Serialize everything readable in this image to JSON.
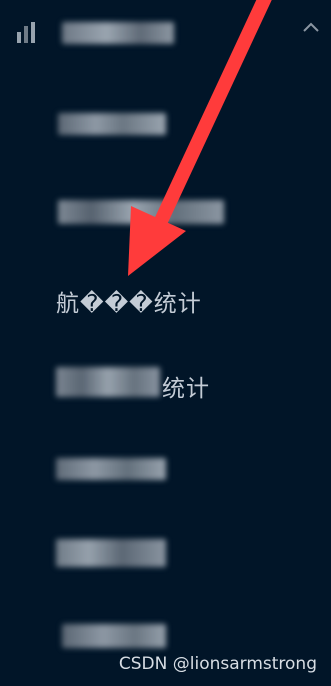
{
  "sidebar": {
    "submenu_icon_name": "bar-chart-icon",
    "chevron_icon_name": "chevron-up-icon",
    "items": [
      {
        "label": "航���统计"
      },
      {
        "label": "统计"
      }
    ]
  },
  "watermark": "CSDN @lionsarmstrong",
  "colors": {
    "sidebar_bg": "#011528",
    "text": "#c4ccd6",
    "annotation_arrow": "#ff3b3b"
  }
}
